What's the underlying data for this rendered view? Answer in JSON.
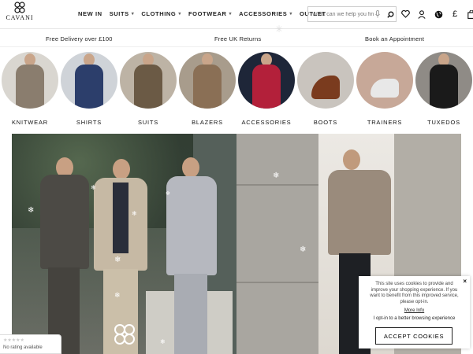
{
  "brand": {
    "name": "CAVANI"
  },
  "nav": [
    {
      "label": "NEW IN",
      "dropdown": false
    },
    {
      "label": "SUITS",
      "dropdown": true
    },
    {
      "label": "CLOTHING",
      "dropdown": true
    },
    {
      "label": "FOOTWEAR",
      "dropdown": true
    },
    {
      "label": "ACCESSORIES",
      "dropdown": true
    },
    {
      "label": "OUTLET",
      "dropdown": false
    }
  ],
  "search": {
    "placeholder": "What can we help you find?"
  },
  "header_icons": [
    "heart-icon",
    "account-icon",
    "globe-icon",
    "currency-icon",
    "bag-icon"
  ],
  "currency_symbol": "£",
  "info_bar": {
    "delivery": "Free Delivery over £100",
    "returns": "Free UK Returns",
    "appointment": "Book an Appointment"
  },
  "categories": [
    {
      "label": "KNITWEAR",
      "bg": "#d9d6d0",
      "garment": "#8a7d6e"
    },
    {
      "label": "SHIRTS",
      "bg": "#cfd3d8",
      "garment": "#2c3e6b"
    },
    {
      "label": "SUITS",
      "bg": "#bdb3a5",
      "garment": "#6b5a45"
    },
    {
      "label": "BLAZERS",
      "bg": "#a89c8c",
      "garment": "#8a6f55"
    },
    {
      "label": "ACCESSORIES",
      "bg": "#1e2638",
      "garment": "#b3203a"
    },
    {
      "label": "BOOTS",
      "bg": "#c9c4be",
      "garment": "#7a3b1e"
    },
    {
      "label": "TRAINERS",
      "bg": "#c7a898",
      "garment": "#e8e8e8"
    },
    {
      "label": "TUXEDOS",
      "bg": "#8f8b86",
      "garment": "#1a1a1a"
    }
  ],
  "cookie": {
    "close": "×",
    "text": "This site uses cookies to provide and improve your shopping experience. If you want to benefit from this improved service, please opt-in.",
    "more_info": "More Info",
    "opt_in": "I opt-in to a better browsing experience",
    "accept": "ACCEPT COOKIES"
  },
  "rating_widget": {
    "stars": "★★★★★",
    "text": "No rating available"
  }
}
